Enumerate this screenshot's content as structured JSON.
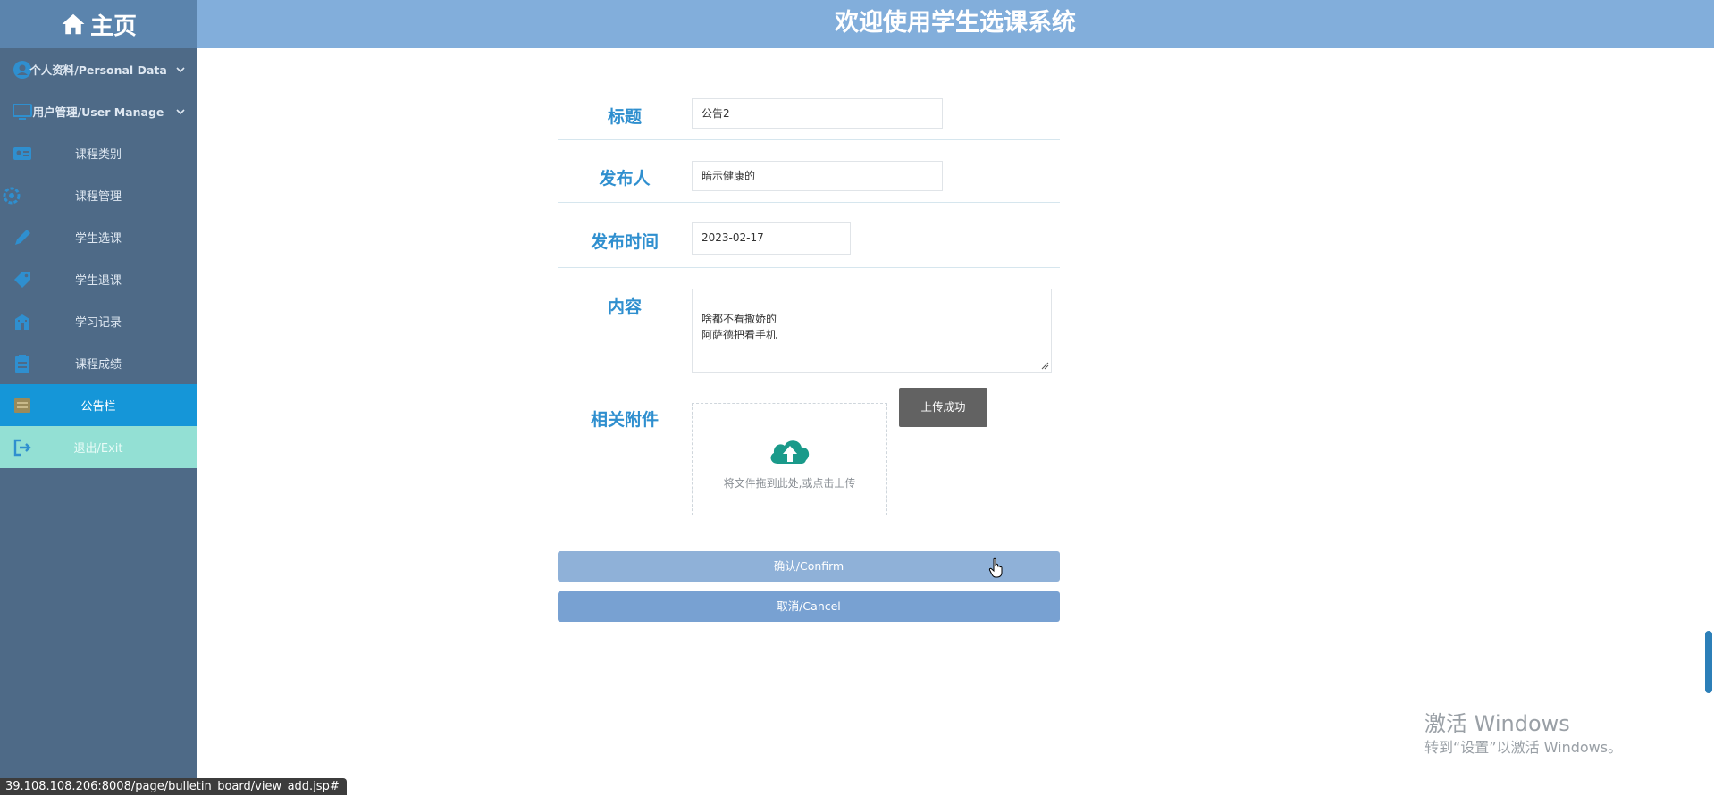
{
  "header": {
    "home_label": "主页",
    "title": "欢迎使用学生选课系统"
  },
  "sidebar": {
    "items": [
      {
        "label": "个人资料/Personal Data",
        "icon": "user-circle-icon"
      },
      {
        "label": "用户管理/User Manage",
        "icon": "monitor-icon"
      },
      {
        "label": "课程类别",
        "icon": "id-card-icon"
      },
      {
        "label": "课程管理",
        "icon": "settings-icon"
      },
      {
        "label": "学生选课",
        "icon": "pen-icon"
      },
      {
        "label": "学生退课",
        "icon": "tag-icon"
      },
      {
        "label": "学习记录",
        "icon": "building-icon"
      },
      {
        "label": "课程成绩",
        "icon": "clipboard-icon"
      },
      {
        "label": "公告栏",
        "icon": "board-icon"
      },
      {
        "label": "退出/Exit",
        "icon": "exit-icon"
      }
    ],
    "active_item": "公告栏"
  },
  "form": {
    "title_label": "标题",
    "title_value": "公告2",
    "publisher_label": "发布人",
    "publisher_value": "暗示健康的",
    "date_label": "发布时间",
    "date_value": "2023-02-17",
    "content_label": "内容",
    "content_value": "啥都不看撒娇的\n阿萨德把看手机",
    "attachment_label": "相关附件",
    "upload_hint": "将文件拖到此处,或点击上传",
    "upload_status": "上传成功",
    "confirm_label": "确认/Confirm",
    "cancel_label": "取消/Cancel"
  },
  "os": {
    "watermark_line1": "激活 Windows",
    "watermark_line2": "转到“设置”以激活 Windows。",
    "status_url": "39.108.108.206:8008/page/bulletin_board/view_add.jsp#"
  },
  "colors": {
    "topbar": "#82aedb",
    "home": "#5b84ad",
    "sidebar": "#4e6a87",
    "active": "#1596d8",
    "exit": "#93e0d4",
    "label": "#2f8fcf",
    "confirm": "#8fb1d8",
    "cancel": "#78a1d2",
    "upload_icon": "#1a9a8a"
  }
}
